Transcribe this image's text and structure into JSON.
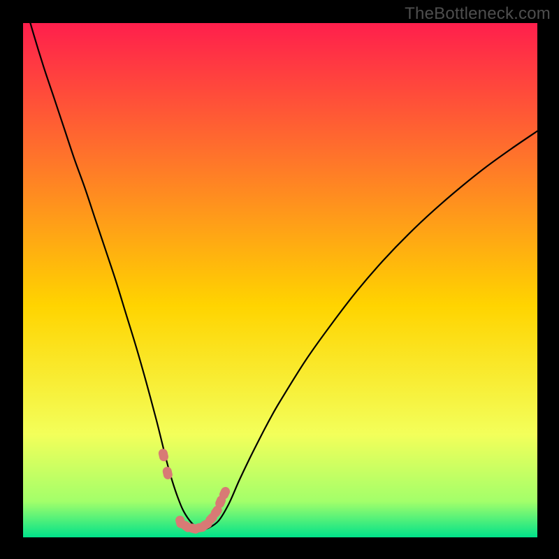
{
  "watermark": "TheBottleneck.com",
  "chart_data": {
    "type": "line",
    "title": "",
    "xlabel": "",
    "ylabel": "",
    "xlim": [
      0,
      100
    ],
    "ylim": [
      0,
      100
    ],
    "grid": false,
    "legend": false,
    "series": [
      {
        "name": "bottleneck-curve",
        "x": [
          0,
          2,
          4,
          6,
          8,
          10,
          12,
          14,
          16,
          18,
          20,
          22,
          24,
          26,
          27,
          28,
          29,
          30,
          31,
          32,
          33,
          34,
          35,
          36,
          38,
          40,
          42,
          44,
          46,
          48,
          50,
          55,
          60,
          65,
          70,
          75,
          80,
          85,
          90,
          95,
          100
        ],
        "y": [
          105,
          98,
          91.5,
          85.5,
          79.5,
          73.5,
          68,
          62,
          56,
          50,
          43.5,
          37,
          30,
          22.5,
          18.5,
          14.5,
          11,
          8,
          5.5,
          3.8,
          2.6,
          2.0,
          1.7,
          1.8,
          3.2,
          6.5,
          11,
          15.2,
          19.2,
          23,
          26.5,
          34.5,
          41.5,
          48,
          53.8,
          59,
          63.7,
          68,
          72,
          75.6,
          79
        ]
      }
    ],
    "highlight_points": {
      "name": "valley-markers",
      "color": "#d87a75",
      "x": [
        27.3,
        28.1,
        30.6,
        31.8,
        33.2,
        34.5,
        35.6,
        36.6,
        37.6,
        38.4,
        39.2
      ],
      "y": [
        16.0,
        12.5,
        3.0,
        2.1,
        1.7,
        1.9,
        2.5,
        3.6,
        5.0,
        6.9,
        8.6
      ]
    },
    "background_gradient": {
      "top_color": "#ff1f4c",
      "upper_mid_color": "#ff7a28",
      "mid_color": "#ffd400",
      "lower_mid_color": "#f3ff5a",
      "bottom_mid_color": "#a3ff6a",
      "bottom_color": "#00e28a"
    }
  }
}
